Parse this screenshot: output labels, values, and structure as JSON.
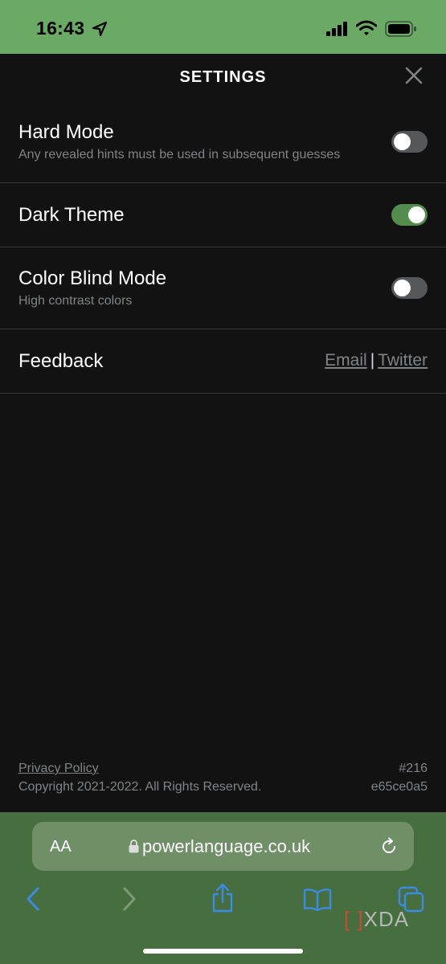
{
  "status_bar": {
    "time": "16:43"
  },
  "header": {
    "title": "SETTINGS"
  },
  "settings": [
    {
      "title": "Hard Mode",
      "description": "Any revealed hints must be used in subsequent guesses",
      "enabled": false
    },
    {
      "title": "Dark Theme",
      "description": "",
      "enabled": true
    },
    {
      "title": "Color Blind Mode",
      "description": "High contrast colors",
      "enabled": false
    }
  ],
  "feedback": {
    "title": "Feedback",
    "email_label": "Email",
    "separator": "|",
    "twitter_label": "Twitter"
  },
  "footer": {
    "privacy_label": "Privacy Policy",
    "copyright": "Copyright 2021-2022. All Rights Reserved.",
    "puzzle_number": "#216",
    "build_hash": "e65ce0a5"
  },
  "browser": {
    "text_size_label": "AA",
    "url": "powerlanguage.co.uk"
  },
  "watermark": {
    "text": "XDA"
  },
  "colors": {
    "status_bar": "#6aaa64",
    "background": "#121213",
    "toggle_on": "#538d4e",
    "toggle_off": "#565758",
    "browser_bar": "#466e3e",
    "link_blue": "#3b8ae6"
  },
  "icons": [
    "location-arrow-icon",
    "signal-icon",
    "wifi-icon",
    "battery-icon",
    "close-icon",
    "lock-icon",
    "reload-icon",
    "back-icon",
    "forward-icon",
    "share-icon",
    "bookmarks-icon",
    "tabs-icon"
  ]
}
